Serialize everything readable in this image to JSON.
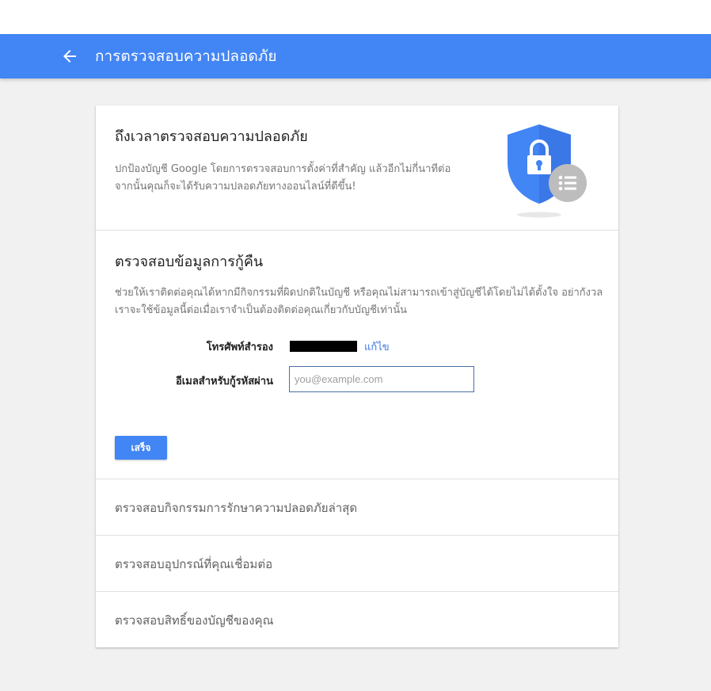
{
  "appbar": {
    "title": "การตรวจสอบความปลอดภัย",
    "back_icon": "arrow-back-icon",
    "color": "#4285f4"
  },
  "intro": {
    "title": "ถึงเวลาตรวจสอบความปลอดภัย",
    "description": "ปกป้องบัญชี Google โดยการตรวจสอบการตั้งค่าที่สำคัญ แล้วอีกไม่กี่นาทีต่อจากนั้นคุณก็จะได้รับความปลอดภัยทางออนไลน์ที่ดีขึ้น!",
    "illustration_icon": "shield-lock-icon"
  },
  "recovery": {
    "title": "ตรวจสอบข้อมูลการกู้คืน",
    "description": "ช่วยให้เราติดต่อคุณได้หากมีกิจกรรมที่ผิดปกติในบัญชี หรือคุณไม่สามารถเข้าสู่บัญชีได้โดยไม่ได้ตั้งใจ อย่ากังวล เราจะใช้ข้อมูลนี้ต่อเมื่อเราจำเป็นต้องติดต่อคุณเกี่ยวกับบัญชีเท่านั้น",
    "phone_label": "โทรศัพท์สำรอง",
    "edit_label": "แก้ไข",
    "email_label": "อีเมลสำหรับกู้รหัสผ่าน",
    "email_value": "",
    "email_placeholder": "you@example.com",
    "done_label": "เสร็จ"
  },
  "sections": [
    {
      "label": "ตรวจสอบกิจกรรมการรักษาความปลอดภัยล่าสุด"
    },
    {
      "label": "ตรวจสอบอุปกรณ์ที่คุณเชื่อมต่อ"
    },
    {
      "label": "ตรวจสอบสิทธิ์ของบัญชีของคุณ"
    }
  ],
  "colors": {
    "accent": "#4285f4",
    "link": "#3b78e7",
    "background": "#f1f1f1"
  }
}
